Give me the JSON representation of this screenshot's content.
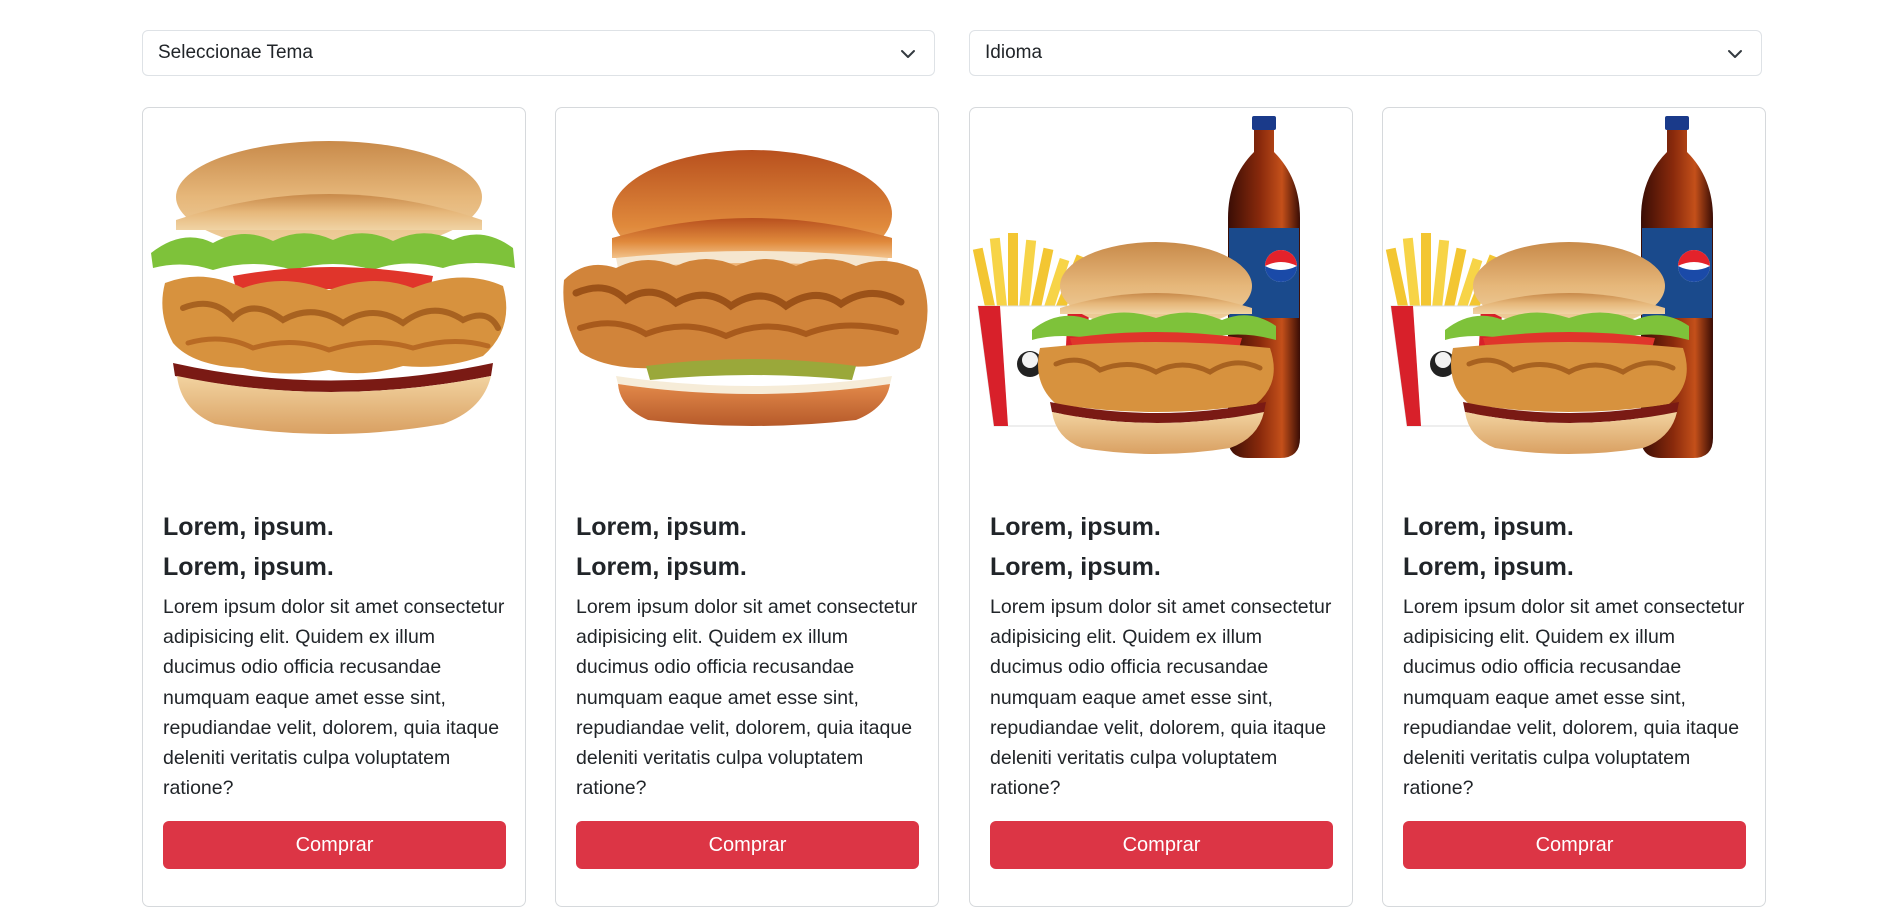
{
  "filters": {
    "theme_label": "Seleccionae Tema",
    "language_label": "Idioma"
  },
  "cards": [
    {
      "title_1": "Lorem, ipsum.",
      "title_2": "Lorem, ipsum.",
      "body": "Lorem ipsum dolor sit amet consectetur adipisicing elit. Quidem ex illum ducimus odio officia recusandae numquam eaque amet esse sint, repudiandae velit, dolorem, quia itaque deleniti veritatis culpa voluptatem ratione?",
      "button": "Comprar",
      "image": "chicken-burger-lettuce-tomato"
    },
    {
      "title_1": "Lorem, ipsum.",
      "title_2": "Lorem, ipsum.",
      "body": "Lorem ipsum dolor sit amet consectetur adipisicing elit. Quidem ex illum ducimus odio officia recusandae numquam eaque amet esse sint, repudiandae velit, dolorem, quia itaque deleniti veritatis culpa voluptatem ratione?",
      "button": "Comprar",
      "image": "crispy-chicken-burger"
    },
    {
      "title_1": "Lorem, ipsum.",
      "title_2": "Lorem, ipsum.",
      "body": "Lorem ipsum dolor sit amet consectetur adipisicing elit. Quidem ex illum ducimus odio officia recusandae numquam eaque amet esse sint, repudiandae velit, dolorem, quia itaque deleniti veritatis culpa voluptatem ratione?",
      "button": "Comprar",
      "image": "combo-burger-fries-pepsi"
    },
    {
      "title_1": "Lorem, ipsum.",
      "title_2": "Lorem, ipsum.",
      "body": "Lorem ipsum dolor sit amet consectetur adipisicing elit. Quidem ex illum ducimus odio officia recusandae numquam eaque amet esse sint, repudiandae velit, dolorem, quia itaque deleniti veritatis culpa voluptatem ratione?",
      "button": "Comprar",
      "image": "combo-burger-fries-pepsi"
    }
  ],
  "colors": {
    "button_bg": "#dc3545",
    "border": "#dee2e6"
  }
}
